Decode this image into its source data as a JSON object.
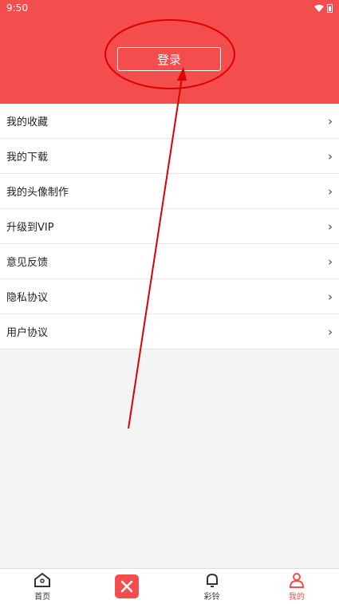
{
  "status": {
    "time": "9:50"
  },
  "header": {
    "login_label": "登录",
    "bg_color": "#f44d4d"
  },
  "menu": [
    {
      "label": "我的收藏"
    },
    {
      "label": "我的下载"
    },
    {
      "label": "我的头像制作"
    },
    {
      "label": "升级到VIP"
    },
    {
      "label": "意见反馈"
    },
    {
      "label": "隐私协议"
    },
    {
      "label": "用户协议"
    }
  ],
  "chevron": "›",
  "tabs": [
    {
      "label": "首页",
      "icon": "home-icon"
    },
    {
      "label": "",
      "icon": "tools-icon"
    },
    {
      "label": "彩铃",
      "icon": "bell-icon"
    },
    {
      "label": "我的",
      "icon": "user-icon"
    }
  ]
}
